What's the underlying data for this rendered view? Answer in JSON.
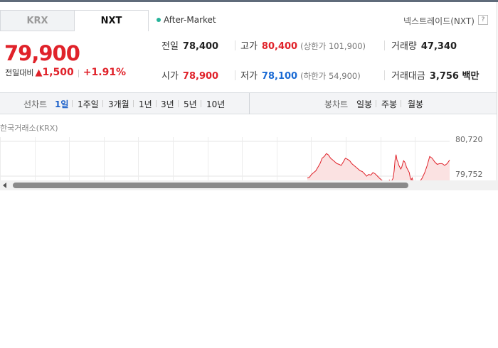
{
  "tabs": [
    {
      "label": "KRX",
      "active": false
    },
    {
      "label": "NXT",
      "active": true
    }
  ],
  "session": {
    "label": "After-Market",
    "dot_color": "#26b39a"
  },
  "market_name": "넥스트레이드(NXT)",
  "help_icon": "?",
  "quote": {
    "price": "79,900",
    "change_label": "전일대비",
    "change_symbol": "▲",
    "change": "1,500",
    "change_pct": "+1.91%",
    "up_color": "#e0222a",
    "down_color": "#1a6ad4"
  },
  "stats": {
    "prev_close": {
      "label": "전일",
      "value": "78,400"
    },
    "high": {
      "label": "고가",
      "value": "80,400",
      "sub": "(상한가 101,900)"
    },
    "volume": {
      "label": "거래량",
      "value": "47,340"
    },
    "open": {
      "label": "시가",
      "value": "78,900"
    },
    "low": {
      "label": "저가",
      "value": "78,100",
      "sub": "(하한가 54,900)"
    },
    "amount": {
      "label": "거래대금",
      "value": "3,756 백만"
    }
  },
  "toolbar": {
    "line_label": "선차트",
    "periods": [
      "1일",
      "1주일",
      "3개월",
      "1년",
      "3년",
      "5년",
      "10년"
    ],
    "active_period": "1일",
    "candle_label": "봉차트",
    "candles": [
      "일봉",
      "주봉",
      "월봉"
    ]
  },
  "chart_title": "한국거래소(KRX)",
  "chart_data": {
    "type": "area",
    "y_ticks": [
      "80,720",
      "79,752"
    ],
    "ylim": [
      79500,
      80720
    ],
    "grid": true,
    "line_color": "#e0222a",
    "fill_color": "#fbe2e2",
    "series": [
      {
        "values": [
          79700,
          79720,
          79800,
          79850,
          79900,
          80000,
          80100,
          80250,
          80300,
          80380,
          80340,
          80250,
          80200,
          80150,
          80100,
          80080,
          80050,
          80150,
          80250,
          80220,
          80180,
          80100,
          80050,
          80000,
          79950,
          79900,
          79880,
          79820,
          79750,
          79800,
          79780,
          79850,
          79820,
          79760,
          79700,
          79650,
          79600,
          79620,
          79600,
          79650
        ]
      },
      {
        "values": [
          79600,
          79650,
          79700,
          79900,
          80200,
          80350,
          80200,
          80150,
          80050,
          80000,
          79950,
          80000,
          80100,
          80180,
          80150,
          80100,
          80000,
          79950,
          79900,
          79850,
          79700,
          79650,
          79700,
          79600,
          79550,
          79600,
          79500,
          79550
        ]
      },
      {
        "values": [
          79600,
          79700,
          79850,
          80050,
          80300,
          80250,
          80150,
          80080,
          80100,
          80100,
          80050,
          80100,
          80200
        ]
      }
    ]
  },
  "scrollbar": {
    "progress": 0.79
  }
}
